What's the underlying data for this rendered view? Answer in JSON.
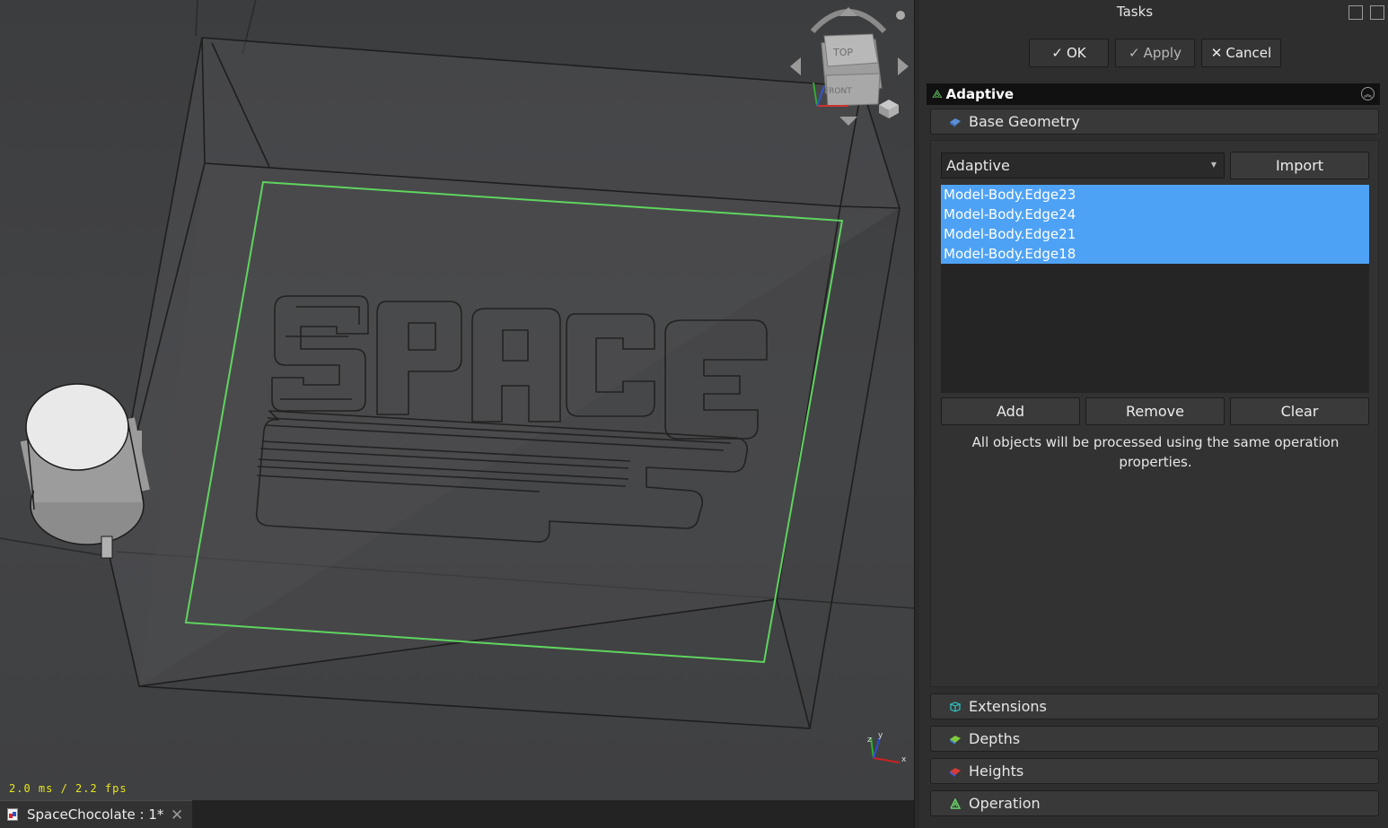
{
  "viewport": {
    "fps_text": "2.0 ms / 2.2 fps",
    "navcube": {
      "top_label": "TOP",
      "front_label": "FRONT"
    },
    "axes": {
      "x": "x",
      "y": "y",
      "z": "z"
    }
  },
  "document_tab": {
    "label": "SpaceChocolate : 1*"
  },
  "task_panel": {
    "title": "Tasks",
    "buttons": {
      "ok": "OK",
      "apply": "Apply",
      "cancel": "Cancel"
    },
    "operation_title": "Adaptive",
    "sections": {
      "base_geometry": "Base Geometry",
      "extensions": "Extensions",
      "depths": "Depths",
      "heights": "Heights",
      "operation": "Operation"
    },
    "base_geometry": {
      "combo_value": "Adaptive",
      "import_label": "Import",
      "items": [
        "Model-Body.Edge23",
        "Model-Body.Edge24",
        "Model-Body.Edge21",
        "Model-Body.Edge18"
      ],
      "add_label": "Add",
      "remove_label": "Remove",
      "clear_label": "Clear",
      "note": "All objects will be processed using the same operation properties."
    }
  },
  "colors": {
    "selection": "#4ea2f5",
    "highlight_edge": "#5fd45f",
    "fps_text": "#e6e61a"
  }
}
